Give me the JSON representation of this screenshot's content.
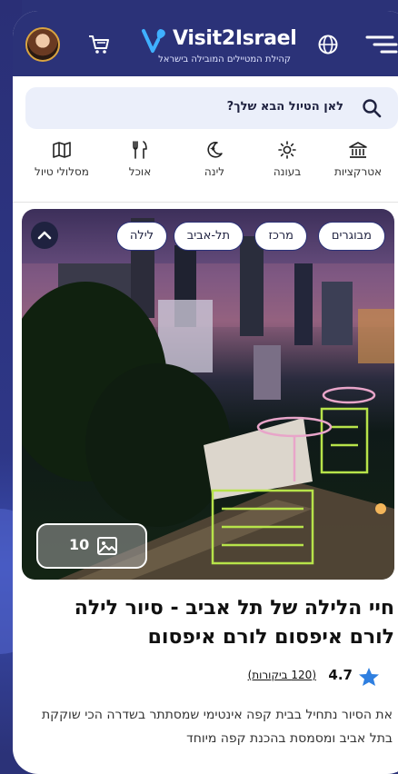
{
  "header": {
    "brand_name": "Visit2Israel",
    "tagline": "קהילת המטיילים המובילה בישראל"
  },
  "search": {
    "placeholder": "לאן הטיול הבא שלך?"
  },
  "categories": [
    {
      "label": "אטרקציות",
      "icon": "landmark-icon"
    },
    {
      "label": "בעונה",
      "icon": "sun-icon"
    },
    {
      "label": "לינה",
      "icon": "moon-icon"
    },
    {
      "label": "אוכל",
      "icon": "cutlery-icon"
    },
    {
      "label": "מסלולי טיול",
      "icon": "map-icon"
    }
  ],
  "tags": [
    "מבוגרים",
    "מרכז",
    "תל-אביב",
    "לילה"
  ],
  "gallery": {
    "count": "10"
  },
  "article": {
    "title": "חיי הלילה של תל אביב - סיור לילה לורם איפסום לורם איפסום",
    "rating": "4.7",
    "reviews": "(120 ביקורות)",
    "description": "את הסיור נתחיל בבית קפה אינטימי שמסתתר בשדרה הכי שוקקת בתל אביב ומסמסת בהכנת קפה מיוחד"
  },
  "colors": {
    "brand_navy": "#2b3278",
    "accent_blue": "#2f7fe0",
    "search_bg": "#ebeffa"
  }
}
